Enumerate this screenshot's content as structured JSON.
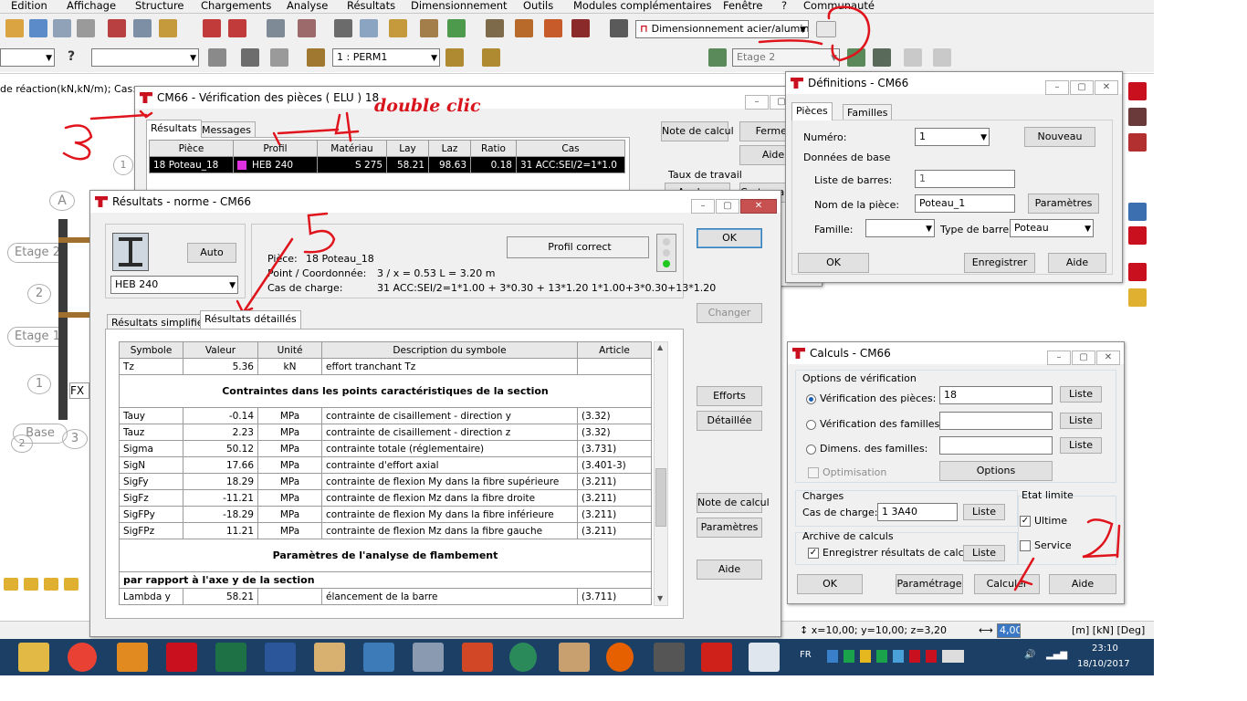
{
  "menubar": [
    "Edition",
    "Affichage",
    "Structure",
    "Chargements",
    "Analyse",
    "Résultats",
    "Dimensionnement",
    "Outils",
    "Modules complémentaires",
    "Fenêtre",
    "?",
    "Communauté"
  ],
  "toolbar": {
    "design_combo": "Dimensionnement acier/alumini",
    "case_combo": "1 : PERM1",
    "storey_combo": "Etage 2",
    "question": "?"
  },
  "background": {
    "reaction_header": "de réaction(kN,kN/m); Cas:",
    "axes": [
      "1",
      "A",
      "2",
      "1",
      "2",
      "3"
    ],
    "storeys": [
      "Etage 2",
      "Etage 1",
      "Base"
    ],
    "node_label": "FX",
    "statusbar_coords": "x=10,00; y=10,00; z=3,20",
    "statusbar_value": "4,00",
    "statusbar_units": "[m] [kN] [Deg]"
  },
  "annotations": {
    "double_clic": "double clic",
    "n3": "3",
    "n4": "4",
    "n5": "5",
    "n2": "2",
    "n1": "1"
  },
  "verif": {
    "title": "CM66 - Vérification des pièces ( ELU ) 18",
    "tabs": [
      "Résultats",
      "Messages"
    ],
    "columns": [
      "Pièce",
      "Profil",
      "Matériau",
      "Lay",
      "Laz",
      "Ratio",
      "Cas"
    ],
    "row": {
      "piece": "18  Poteau_18",
      "profil": "HEB 240",
      "materiau": "S 275",
      "lay": "58.21",
      "laz": "98.63",
      "ratio": "0.18",
      "cas": "31 ACC:SEI/2=1*1.0"
    },
    "btn_note": "Note de calcul",
    "btn_fermer": "Fermer",
    "btn_aide": "Aide",
    "taux_label": "Taux de travail",
    "btn_cartographie": "Cartographie",
    "btn_analyse": "Analyse"
  },
  "defs": {
    "title": "Définitions - CM66",
    "tabs": [
      "Pièces",
      "Familles"
    ],
    "numero_label": "Numéro:",
    "numero_value": "1",
    "btn_nouveau": "Nouveau",
    "donnees_label": "Données de base",
    "liste_label": "Liste de barres:",
    "liste_value": "1",
    "nom_label": "Nom de la pièce:",
    "nom_value": "Poteau_1",
    "btn_parametres": "Paramètres",
    "famille_label": "Famille:",
    "type_label": "Type de barre:",
    "type_value": "Poteau",
    "btn_ok": "OK",
    "btn_enregistrer": "Enregistrer",
    "btn_aide": "Aide"
  },
  "calc": {
    "title": "Calculs - CM66",
    "options_label": "Options de vérification",
    "opt_pieces": "Vérification des pièces:",
    "opt_pieces_value": "18",
    "opt_familles": "Vérification des familles:",
    "opt_dimens": "Dimens. des familles:",
    "btn_liste": "Liste",
    "optimisation": "Optimisation",
    "btn_options": "Options",
    "charges_label": "Charges",
    "cas_label": "Cas de charge:",
    "cas_value": "1 3A40",
    "etat_label": "Etat limite",
    "ultime": "Ultime",
    "service": "Service",
    "archive_label": "Archive de calculs",
    "enregistrer": "Enregistrer résultats de calculs",
    "btn_ok": "OK",
    "btn_parametrage": "Paramétrage",
    "btn_calculer": "Calculer",
    "btn_aide": "Aide"
  },
  "results": {
    "title": "Résultats - norme - CM66",
    "btn_auto": "Auto",
    "section_combo": "HEB 240",
    "profil_status": "Profil correct",
    "piece_label": "Pièce:",
    "piece_value": "18  Poteau_18",
    "point_label": "Point / Coordonnée:",
    "point_value": "3 / x = 0.53 L = 3.20 m",
    "cas_label": "Cas de charge:",
    "cas_value": "31 ACC:SEI/2=1*1.00 + 3*0.30 + 13*1.20  1*1.00+3*0.30+13*1.20",
    "tabs": [
      "Résultats simplifiés",
      "Résultats détaillés"
    ],
    "columns": [
      "Symbole",
      "Valeur",
      "Unité",
      "Description du symbole",
      "Article"
    ],
    "rows": [
      {
        "s": "Tz",
        "v": "5.36",
        "u": "kN",
        "d": "effort tranchant Tz",
        "a": ""
      },
      {
        "section": "Contraintes dans les points caractéristiques de la section"
      },
      {
        "s": "Tauy",
        "v": "-0.14",
        "u": "MPa",
        "d": "contrainte de cisaillement - direction y",
        "a": "(3.32)"
      },
      {
        "s": "Tauz",
        "v": "2.23",
        "u": "MPa",
        "d": "contrainte de cisaillement - direction z",
        "a": "(3.32)"
      },
      {
        "s": "Sigma",
        "v": "50.12",
        "u": "MPa",
        "d": "contrainte totale (réglementaire)",
        "a": "(3.731)"
      },
      {
        "s": "SigN",
        "v": "17.66",
        "u": "MPa",
        "d": "contrainte d'effort axial",
        "a": "(3.401-3)"
      },
      {
        "s": "SigFy",
        "v": "18.29",
        "u": "MPa",
        "d": "contrainte de flexion My dans la fibre supérieure",
        "a": "(3.211)"
      },
      {
        "s": "SigFz",
        "v": "-11.21",
        "u": "MPa",
        "d": "contrainte de flexion Mz dans la fibre droite",
        "a": "(3.211)"
      },
      {
        "s": "SigFPy",
        "v": "-18.29",
        "u": "MPa",
        "d": "contrainte de flexion My dans la fibre inférieure",
        "a": "(3.211)"
      },
      {
        "s": "SigFPz",
        "v": "11.21",
        "u": "MPa",
        "d": "contrainte de flexion Mz dans la fibre gauche",
        "a": "(3.211)"
      },
      {
        "section": "Paramètres de l'analyse de flambement"
      },
      {
        "subsection": "par rapport à l'axe y de la section"
      },
      {
        "s": "Lambda y",
        "v": "58.21",
        "u": "",
        "d": "élancement de la barre",
        "a": "(3.711)"
      }
    ],
    "btn_ok": "OK",
    "btn_changer": "Changer",
    "btn_efforts": "Efforts",
    "btn_detaillee": "Détaillée",
    "btn_note": "Note de calcul",
    "btn_parametres": "Paramètres",
    "btn_aide": "Aide"
  },
  "taskbar": {
    "lang": "FR",
    "time": "23:10",
    "date": "18/10/2017"
  }
}
